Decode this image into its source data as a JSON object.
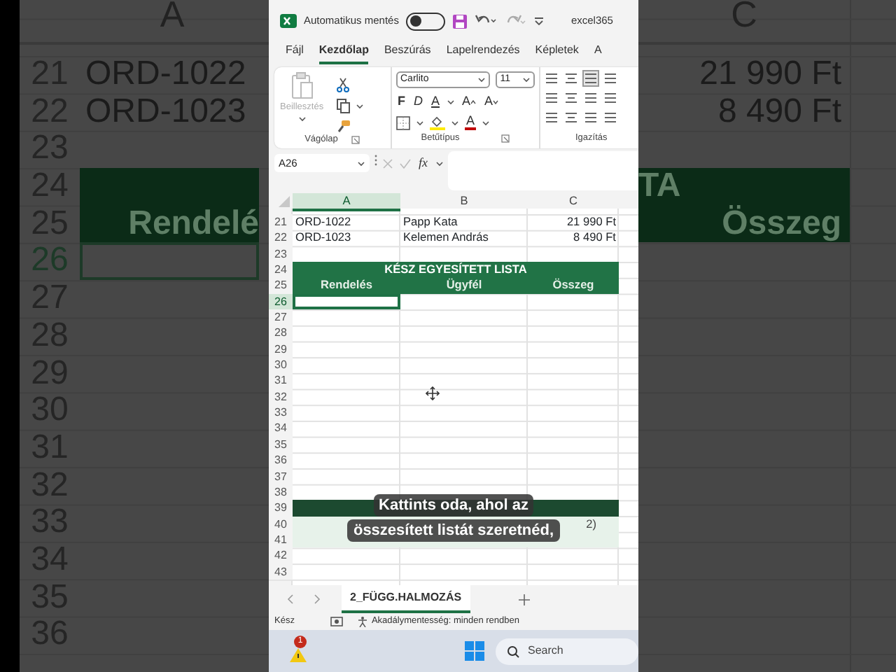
{
  "backdrop": {
    "left_column": "A",
    "right_column": "C",
    "rows": [
      {
        "number": "21",
        "kind": "data",
        "left": "ORD-1022",
        "right": "21 990 Ft",
        "selected": false
      },
      {
        "number": "22",
        "kind": "data",
        "left": "ORD-1023",
        "right": "8 490 Ft",
        "selected": false
      },
      {
        "number": "23",
        "kind": "empty",
        "selected": false
      },
      {
        "number": "24",
        "kind": "band",
        "right": "TA",
        "selected": false
      },
      {
        "number": "25",
        "kind": "band",
        "left": "Rendelé",
        "right": "Összeg",
        "selected": false
      },
      {
        "number": "26",
        "kind": "empty",
        "selected": true
      },
      {
        "number": "27",
        "kind": "empty",
        "selected": false
      },
      {
        "number": "28",
        "kind": "empty",
        "selected": false
      },
      {
        "number": "29",
        "kind": "empty",
        "selected": false
      },
      {
        "number": "30",
        "kind": "empty",
        "selected": false
      },
      {
        "number": "31",
        "kind": "empty",
        "selected": false
      },
      {
        "number": "32",
        "kind": "empty",
        "selected": false
      },
      {
        "number": "33",
        "kind": "empty",
        "selected": false
      },
      {
        "number": "34",
        "kind": "empty",
        "selected": false
      },
      {
        "number": "35",
        "kind": "empty",
        "selected": false
      },
      {
        "number": "36",
        "kind": "empty",
        "selected": false
      }
    ]
  },
  "title_bar": {
    "autosave_label": "Automatikus mentés",
    "autosave_on": false,
    "file_name": "excel365"
  },
  "ribbon_tabs": [
    {
      "label": "Fájl",
      "selected": false
    },
    {
      "label": "Kezdőlap",
      "selected": true
    },
    {
      "label": "Beszúrás",
      "selected": false
    },
    {
      "label": "Lapelrendezés",
      "selected": false
    },
    {
      "label": "Képletek",
      "selected": false
    },
    {
      "label": "A",
      "selected": false
    }
  ],
  "ribbon": {
    "clipboard": {
      "paste_label": "Beillesztés",
      "paste_disabled": true,
      "group_label": "Vágólap"
    },
    "font": {
      "font_name": "Carlito",
      "font_size": "11",
      "bold_label": "F",
      "italic_label": "D",
      "underline_label": "A",
      "grow_label": "A",
      "shrink_label": "A",
      "font_color_label": "A",
      "group_label": "Betűtípus"
    },
    "alignment": {
      "group_label": "Igazítás"
    }
  },
  "formula_bar": {
    "name_box": "A26",
    "fx_label": "fx"
  },
  "sheet": {
    "columns": [
      {
        "label": "A",
        "selected": true
      },
      {
        "label": "B",
        "selected": false
      },
      {
        "label": "C",
        "selected": false
      }
    ],
    "rows": [
      {
        "number": "21",
        "kind": "data",
        "cells": [
          "ORD-1022",
          "Papp Kata",
          "21 990 Ft"
        ],
        "selected": false
      },
      {
        "number": "22",
        "kind": "data",
        "cells": [
          "ORD-1023",
          "Kelemen András",
          "8 490 Ft"
        ],
        "selected": false
      },
      {
        "number": "23",
        "kind": "empty",
        "selected": false
      },
      {
        "number": "24",
        "kind": "title",
        "cells": [
          "KÉSZ EGYESÍTETT LISTA"
        ],
        "selected": false
      },
      {
        "number": "25",
        "kind": "header",
        "cells": [
          "Rendelés",
          "Ügyfél",
          "Összeg"
        ],
        "selected": false
      },
      {
        "number": "26",
        "kind": "empty",
        "selected": true
      },
      {
        "number": "27",
        "kind": "empty",
        "selected": false
      },
      {
        "number": "28",
        "kind": "empty",
        "selected": false
      },
      {
        "number": "29",
        "kind": "empty",
        "selected": false
      },
      {
        "number": "30",
        "kind": "empty",
        "selected": false
      },
      {
        "number": "31",
        "kind": "empty",
        "selected": false
      },
      {
        "number": "32",
        "kind": "empty",
        "selected": false
      },
      {
        "number": "33",
        "kind": "empty",
        "selected": false
      },
      {
        "number": "34",
        "kind": "empty",
        "selected": false
      },
      {
        "number": "35",
        "kind": "empty",
        "selected": false
      },
      {
        "number": "36",
        "kind": "empty",
        "selected": false
      },
      {
        "number": "37",
        "kind": "empty",
        "selected": false
      },
      {
        "number": "38",
        "kind": "empty",
        "selected": false
      },
      {
        "number": "39",
        "kind": "dark",
        "selected": false
      },
      {
        "number": "40",
        "kind": "light",
        "cells": [
          "2)"
        ],
        "selected": false
      },
      {
        "number": "41",
        "kind": "light",
        "selected": false
      },
      {
        "number": "42",
        "kind": "empty",
        "selected": false
      },
      {
        "number": "43",
        "kind": "empty",
        "selected": false
      }
    ]
  },
  "caption": {
    "lines": [
      "Kattints oda, ahol az",
      "összesített listát szeretnéd,"
    ]
  },
  "sheet_tabs": [
    {
      "label": "2_FÜGG.HALMOZÁS",
      "selected": true
    }
  ],
  "status_bar": {
    "ready": "Kész",
    "accessibility": "Akadálymentesség: minden rendben"
  },
  "taskbar": {
    "notification_count": "1",
    "search_label": "Search"
  }
}
